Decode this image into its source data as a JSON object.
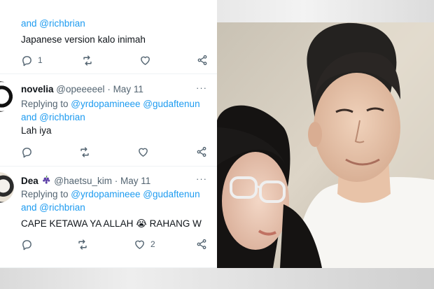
{
  "tweets": [
    {
      "reply_mentions_tail": "and @richbrian",
      "text": "Japanese version kalo inimah",
      "reply_count": "1",
      "like_count": ""
    },
    {
      "name": "novelia",
      "emoji": "",
      "handle": "@opeeeeel",
      "date": "May 11",
      "more": "···",
      "reply_prefix": "Replying to ",
      "reply_mentions_1": "@yrdopamineee @gudaftenun",
      "reply_mentions_2": "and @richbrian",
      "text": "Lah iya",
      "reply_count": "",
      "like_count": ""
    },
    {
      "name": "Dea",
      "emoji": "grapes-icon",
      "handle": "@haetsu_kim",
      "date": "May 11",
      "more": "···",
      "reply_prefix": "Replying to ",
      "reply_mentions_1": "@yrdopamineee @gudaftenun",
      "reply_mentions_2": "and @richbrian",
      "text": "CAPE KETAWA YA ALLAH 😭 RAHANG W",
      "reply_count": "",
      "like_count": "2"
    }
  ],
  "separator": " · ",
  "colors": {
    "mention": "#1d9bf0",
    "secondary_text": "#536471",
    "primary_text": "#0f1419"
  }
}
